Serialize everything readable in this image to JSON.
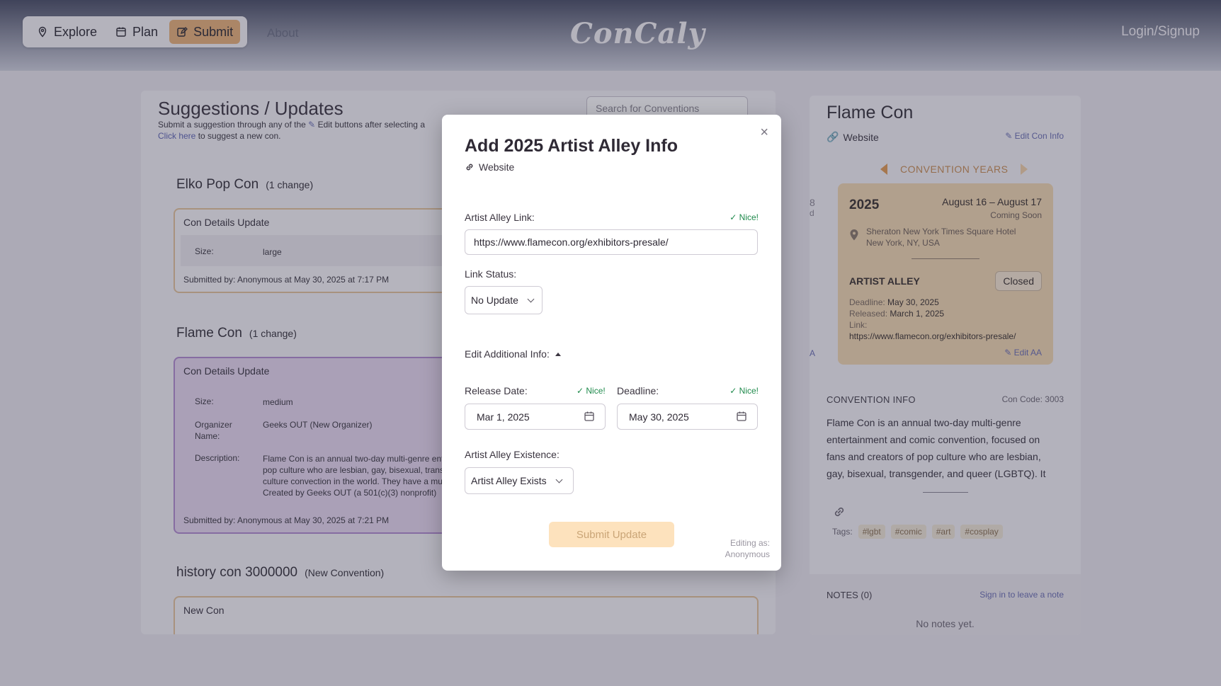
{
  "nav": {
    "explore": "Explore",
    "plan": "Plan",
    "submit": "Submit",
    "about": "About",
    "brand": "ConCaly",
    "login": "Login/Signup"
  },
  "left": {
    "title": "Suggestions / Updates",
    "subtitle_pre": "Submit a suggestion through any of the",
    "subtitle_post": "Edit buttons after selecting a",
    "click_here": "Click here",
    "suggest_text": "to suggest a new con.",
    "search_placeholder": "Search for Conventions",
    "groups": [
      {
        "name": "Elko Pop Con",
        "count": "(1 change)",
        "card_title": "Con Details Update",
        "rows": [
          {
            "key": "Size:",
            "value": "large"
          }
        ],
        "submitted": "Submitted by: Anonymous at May 30, 2025 at 7:17 PM"
      },
      {
        "name": "Flame Con",
        "count": "(1 change)",
        "card_title": "Con Details Update",
        "rows": [
          {
            "key": "Size:",
            "value": "medium"
          },
          {
            "key": "Organizer Name:",
            "value": "Geeks OUT (New Organizer)"
          },
          {
            "key": "Description:",
            "value": "Flame Con is an annual two-day multi-genre ent pop culture who are lesbian, gay, bisexual, trans culture convection in the world. They have a mul Created by Geeks OUT (a 501(c)(3) nonprofit)"
          }
        ],
        "submitted": "Submitted by: Anonymous at May 30, 2025 at 7:21 PM"
      },
      {
        "name": "history con 3000000",
        "count": "(New Convention)",
        "card_title": "New Con"
      }
    ]
  },
  "right": {
    "title": "Flame Con",
    "website": "Website",
    "edit_con": "Edit Con Info",
    "years_label": "CONVENTION YEARS",
    "year": "2025",
    "dates": "August 16 – August 17",
    "status": "Coming Soon",
    "location_line1": "Sheraton New York Times Square Hotel",
    "location_line2": "New York, NY, USA",
    "aa_label": "ARTIST ALLEY",
    "aa_status": "Closed",
    "deadline_k": "Deadline:",
    "deadline_v": "May 30, 2025",
    "released_k": "Released:",
    "released_v": "March 1, 2025",
    "link_k": "Link:",
    "link_v": "https://www.flamecon.org/exhibitors-presale/",
    "edit_aa": "Edit AA",
    "conv_info": "CONVENTION INFO",
    "con_code": "Con Code: 3003",
    "description": "Flame Con is an annual two-day multi-genre entertainment and comic convention, focused on fans and creators of pop culture who are lesbian, gay, bisexual, transgender, and queer (LGBTQ). It",
    "tags_label": "Tags:",
    "tags": [
      "#lgbt",
      "#comic",
      "#art",
      "#cosplay"
    ],
    "notes_head": "NOTES (0)",
    "notes_signin": "Sign in to leave a note",
    "no_notes": "No notes yet.",
    "peek_1": "8",
    "peek_2": "d",
    "peek_3": "A"
  },
  "modal": {
    "title": "Add 2025 Artist Alley Info",
    "website": "Website",
    "close": "×",
    "link_label": "Artist Alley Link:",
    "link_nice": "✓ Nice!",
    "link_value": "https://www.flamecon.org/exhibitors-presale/",
    "status_label": "Link Status:",
    "status_value": "No Update",
    "additional": "Edit Additional Info:",
    "release_label": "Release Date:",
    "release_nice": "✓ Nice!",
    "release_value": "Mar 1, 2025",
    "deadline_label": "Deadline:",
    "deadline_nice": "✓ Nice!",
    "deadline_value": "May 30, 2025",
    "existence_label": "Artist Alley Existence:",
    "existence_value": "Artist Alley Exists",
    "submit": "Submit Update",
    "editing_as": "Editing as:",
    "editing_user": "Anonymous"
  }
}
